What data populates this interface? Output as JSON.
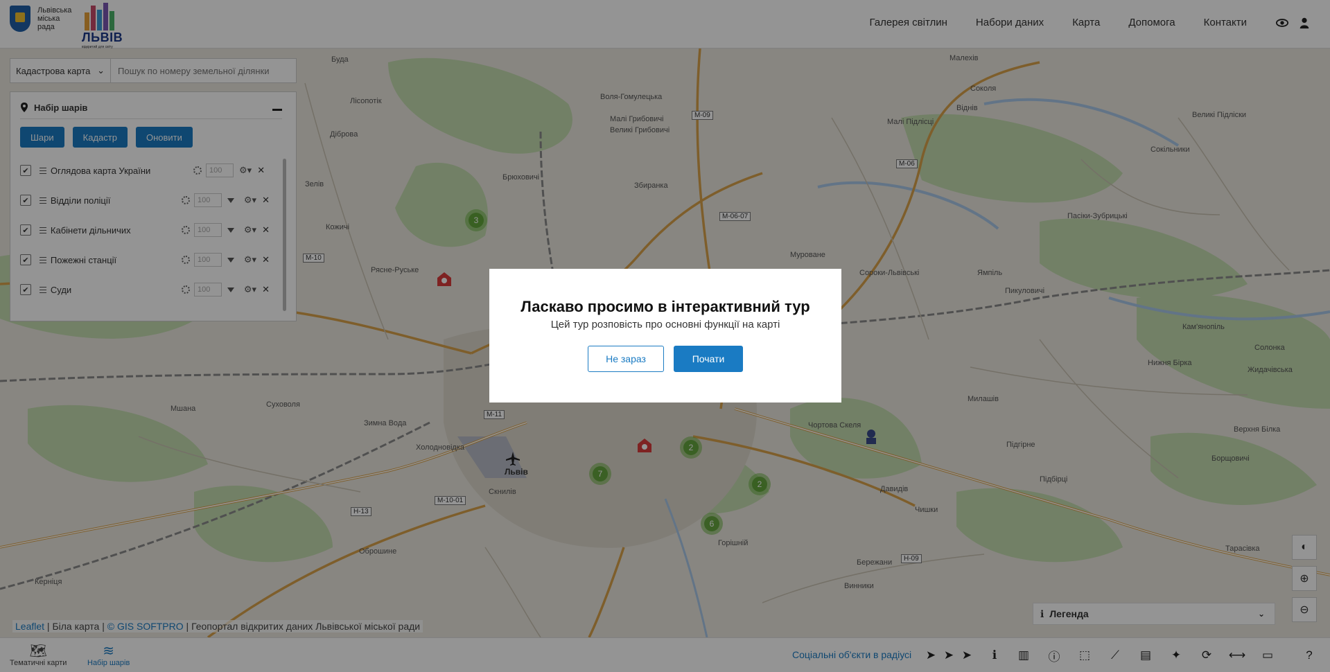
{
  "header": {
    "council": [
      "Львівська",
      "міська",
      "рада"
    ],
    "brand": "ЛЬВІВ",
    "brand_sub": "відкритий для світу",
    "nav": [
      "Галерея світлин",
      "Набори даних",
      "Карта",
      "Допомога",
      "Контакти"
    ]
  },
  "search": {
    "select_value": "Кадастрова карта",
    "placeholder": "Пошук по номеру земельної ділянки"
  },
  "layers_panel": {
    "title": "Набір шарів",
    "buttons": [
      "Шари",
      "Кадастр",
      "Оновити"
    ],
    "rows": [
      {
        "name": "Оглядова карта України",
        "opacity": "100",
        "checked": true,
        "has_filter": false
      },
      {
        "name": "Відділи поліції",
        "opacity": "100",
        "checked": true,
        "has_filter": true
      },
      {
        "name": "Кабінети дільничих",
        "opacity": "100",
        "checked": true,
        "has_filter": true
      },
      {
        "name": "Пожежні станції",
        "opacity": "100",
        "checked": true,
        "has_filter": true
      },
      {
        "name": "Суди",
        "opacity": "100",
        "checked": true,
        "has_filter": true
      }
    ]
  },
  "map": {
    "places": [
      "Буда",
      "Малехів",
      "Соколя",
      "Лісопотік",
      "Віднів",
      "Воля-Гомулецька",
      "Малі Підлісці",
      "Великі Підліски",
      "Сокільники",
      "Зимна Вода",
      "Рясне-Руське",
      "Малі Грибовичі",
      "Великі Грибовичі",
      "Брюховичі",
      "Збиранка",
      "Мурованe",
      "Сороки-Львівські",
      "Ямпіль",
      "Пикуловичі",
      "Дібровa",
      "Зелів",
      "Кожичі",
      "Львів",
      "Скнилів",
      "Холодновідка",
      "Суховоля",
      "Мшана",
      "Оброшине",
      "Винники",
      "Чишки",
      "Підбірці",
      "Тарасівка",
      "Борщовичі",
      "Нижня Бірка",
      "Жидачівська",
      "Кернiця",
      "Солонка",
      "Верхня Білка",
      "Милашів",
      "Чортова Скеля",
      "Підгірне",
      "Пасіки-Зубрицькі",
      "Горішній",
      "Бережани",
      "Кам'янопіль",
      "Давидів"
    ],
    "roads": [
      "М-09",
      "М-06",
      "М-10",
      "М-11",
      "Н-13",
      "М-10-01",
      "М-06-07",
      "Н-09"
    ],
    "clusters": [
      3,
      2,
      7,
      2,
      6
    ]
  },
  "modal": {
    "title": "Ласкаво просимо в інтерактивний тур",
    "subtitle": "Цей тур розповість про основні функції на карті",
    "later": "Не зараз",
    "start": "Почати"
  },
  "attribution": {
    "leaflet": "Leaflet",
    "sep1": " | Біла карта | ",
    "gis": "© GIS SOFTPRO",
    "rest": " | Геопортал відкритих даних Львівської міської ради"
  },
  "legend": {
    "label": "Легенда"
  },
  "toolbar": {
    "tab_thematic": "Тематичні карти",
    "tab_layers": "Набір шарів",
    "social": "Соціальні об'єкти в радіусі"
  },
  "colors": {
    "accent": "#1a7bc3",
    "cluster": "#5aa032",
    "overlay": "rgba(0,0,0,0.42)"
  }
}
